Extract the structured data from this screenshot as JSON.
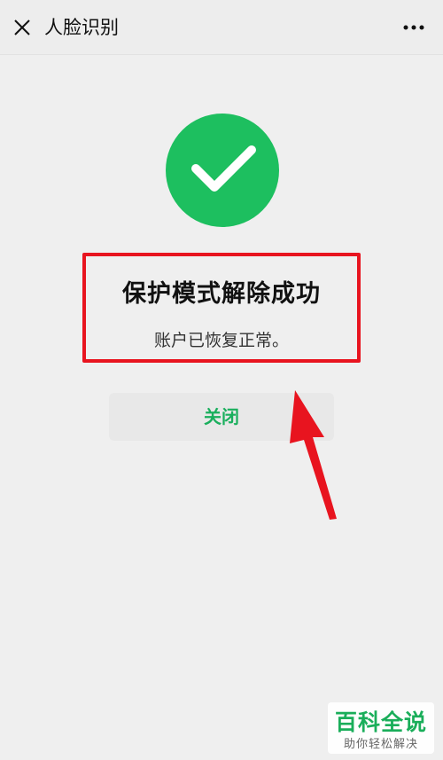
{
  "header": {
    "title": "人脸识别",
    "close_icon": "close-icon",
    "more_icon": "more-icon"
  },
  "result": {
    "icon": "check-circle-icon",
    "icon_color": "#1dbf5f",
    "title": "保护模式解除成功",
    "description": "账户已恢复正常。"
  },
  "actions": {
    "close_label": "关闭",
    "close_color": "#1aaf5d"
  },
  "annotation": {
    "box_color": "#e8141f",
    "arrow_color": "#e8141f"
  },
  "watermark": {
    "title": "百科全说",
    "subtitle": "助你轻松解决"
  }
}
